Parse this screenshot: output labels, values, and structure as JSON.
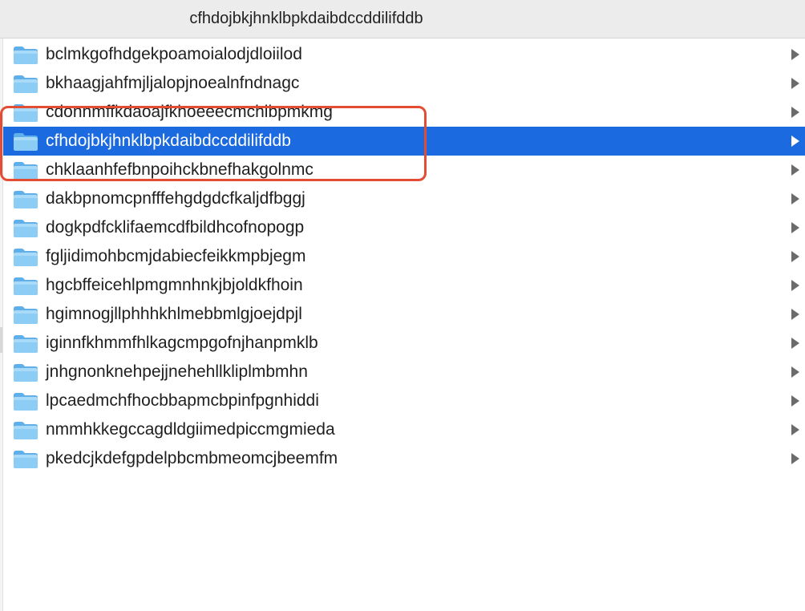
{
  "window": {
    "column_title": "cfhdojbkjhnklbpkdaibdccddilifddb"
  },
  "colors": {
    "selection": "#1c6ae0",
    "folder": "#7cc2f2",
    "annotation": "#e34d33"
  },
  "list": {
    "items": [
      {
        "label": "bclmkgofhdgekpoamoialodjdloiilod",
        "icon": "folder-icon",
        "selected": false
      },
      {
        "label": "bkhaagjahfmjljalopjnoealnfndnagc",
        "icon": "folder-icon",
        "selected": false
      },
      {
        "label": "cdonnmffkdaoajfkhoeeecmchibpmkmg",
        "icon": "folder-icon",
        "selected": false
      },
      {
        "label": "cfhdojbkjhnklbpkdaibdccddilifddb",
        "icon": "folder-icon",
        "selected": true
      },
      {
        "label": "chklaanhfefbnpoihckbnefhakgolnmc",
        "icon": "folder-icon",
        "selected": false
      },
      {
        "label": "dakbpnomcpnfffehgdgdcfkaljdfbggj",
        "icon": "folder-icon",
        "selected": false
      },
      {
        "label": "dogkpdfcklifaemcdfbildhcofnopogp",
        "icon": "folder-icon",
        "selected": false
      },
      {
        "label": "fgljidimohbcmjdabiecfeikkmpbjegm",
        "icon": "folder-icon",
        "selected": false
      },
      {
        "label": "hgcbffeicehlpmgmnhnkjbjoldkfhoin",
        "icon": "folder-icon",
        "selected": false
      },
      {
        "label": "hgimnogjllphhhkhlmebbmlgjoejdpjl",
        "icon": "folder-icon",
        "selected": false
      },
      {
        "label": "iginnfkhmmfhlkagcmpgofnjhanpmklb",
        "icon": "folder-icon",
        "selected": false
      },
      {
        "label": "jnhgnonknehpejjnehehllkliplmbmhn",
        "icon": "folder-icon",
        "selected": false
      },
      {
        "label": "lpcaedmchfhocbbapmcbpinfpgnhiddi",
        "icon": "folder-icon",
        "selected": false
      },
      {
        "label": "nmmhkkegccagdldgiimedpiccmgmieda",
        "icon": "folder-icon",
        "selected": false
      },
      {
        "label": "pkedcjkdefgpdelpbcmbmeomcjbeemfm",
        "icon": "folder-icon",
        "selected": false
      }
    ]
  }
}
